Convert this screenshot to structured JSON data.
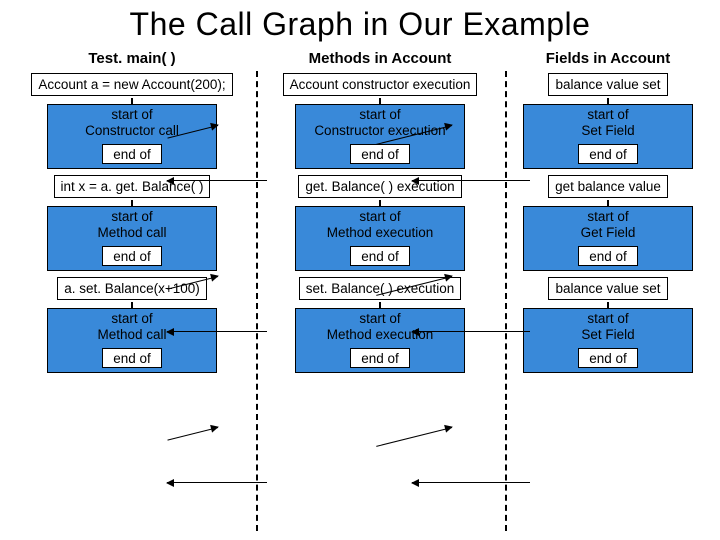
{
  "title": "The Call Graph in Our Example",
  "columns": {
    "c1": "Test. main( )",
    "c2": "Methods in Account",
    "c3": "Fields in Account"
  },
  "rows": [
    {
      "c1_box": "Account a = new Account(200);",
      "c1_sub1": "start of",
      "c1_sub2": "Constructor call",
      "c1_end": "end of",
      "c2_box": "Account constructor execution",
      "c2_sub1": "start of",
      "c2_sub2": "Constructor execution",
      "c2_end": "end of",
      "c3_box": "balance value set",
      "c3_sub1": "start of",
      "c3_sub2": "Set Field",
      "c3_end": "end of"
    },
    {
      "c1_box": "int x = a. get. Balance( )",
      "c1_sub1": "start of",
      "c1_sub2": "Method call",
      "c1_end": "end of",
      "c2_box": "get. Balance( ) execution",
      "c2_sub1": "start of",
      "c2_sub2": "Method execution",
      "c2_end": "end of",
      "c3_box": "get balance value",
      "c3_sub1": "start of",
      "c3_sub2": "Get Field",
      "c3_end": "end of"
    },
    {
      "c1_box": "a. set. Balance(x+100)",
      "c1_sub1": "start of",
      "c1_sub2": "Method call",
      "c1_end": "end of",
      "c2_box": "set. Balance( ) execution",
      "c2_sub1": "start of",
      "c2_sub2": "Method execution",
      "c2_end": "end of",
      "c3_box": "balance value set",
      "c3_sub1": "start of",
      "c3_sub2": "Set Field",
      "c3_end": "end of"
    }
  ]
}
